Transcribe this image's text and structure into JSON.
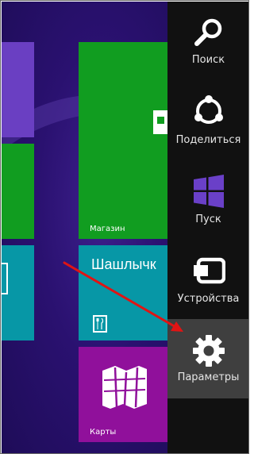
{
  "start_screen": {
    "tiles": {
      "store_label": "Магазин",
      "kebab_title": "Шашлычк",
      "maps_label": "Карты"
    }
  },
  "charms_bar": {
    "items": [
      {
        "label": "Поиск",
        "icon": "search-icon"
      },
      {
        "label": "Поделиться",
        "icon": "share-icon"
      },
      {
        "label": "Пуск",
        "icon": "windows-logo-icon"
      },
      {
        "label": "Устройства",
        "icon": "devices-icon"
      },
      {
        "label": "Параметры",
        "icon": "gear-icon",
        "highlighted": true
      }
    ]
  },
  "colors": {
    "background": "#2a1170",
    "charms_bg": "#111111",
    "charm_active_bg": "#3f3f3f",
    "tile_purple": "#6a3fc2",
    "tile_green": "#119d20",
    "tile_teal": "#0797a6",
    "tile_magenta": "#90109b",
    "windows_logo": "#6a40c8",
    "annotation_arrow": "#e01414"
  }
}
